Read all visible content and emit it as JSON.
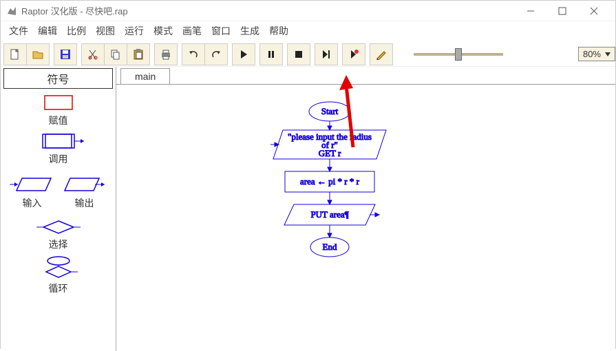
{
  "window": {
    "title": "Raptor 汉化版 - 尽快吧.rap"
  },
  "menu": {
    "file": "文件",
    "edit": "编辑",
    "scale": "比例",
    "view": "视图",
    "run": "运行",
    "mode": "模式",
    "brush": "画笔",
    "windowm": "窗口",
    "generate": "生成",
    "help": "帮助"
  },
  "zoom": {
    "value": "80%"
  },
  "side": {
    "title": "符号",
    "assign": "赋值",
    "call": "调用",
    "input": "输入",
    "output": "输出",
    "select": "选择",
    "loop": "循环"
  },
  "tabs": {
    "main": "main"
  },
  "flow": {
    "start": "Start",
    "input_l1": "\"please input the radius",
    "input_l2": "of r\"",
    "input_l3": "GET r",
    "process": "area ← pi * r * r",
    "output": "PUT area¶",
    "end": "End"
  }
}
